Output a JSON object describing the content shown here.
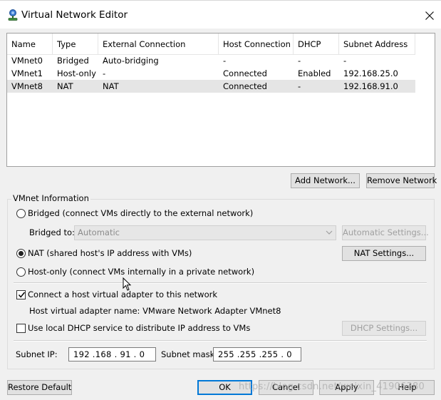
{
  "window": {
    "title": "Virtual Network Editor"
  },
  "table": {
    "columns": [
      "Name",
      "Type",
      "External Connection",
      "Host Connection",
      "DHCP",
      "Subnet Address"
    ],
    "rows": [
      [
        "VMnet0",
        "Bridged",
        "Auto-bridging",
        "-",
        "-",
        "-"
      ],
      [
        "VMnet1",
        "Host-only",
        "-",
        "Connected",
        "Enabled",
        "192.168.25.0"
      ],
      [
        "VMnet8",
        "NAT",
        "NAT",
        "Connected",
        "-",
        "192.168.91.0"
      ]
    ],
    "selected_row": "VMnet8"
  },
  "network_buttons": {
    "add": "Add Network...",
    "remove": "Remove Network"
  },
  "vmnet_info": {
    "title": "VMnet Information",
    "bridged_label": "Bridged (connect VMs directly to the external network)",
    "bridged_to_label": "Bridged to:",
    "bridged_to_value": "Automatic",
    "auto_settings_label": "Automatic Settings...",
    "nat_label": "NAT (shared host's IP address with VMs)",
    "nat_settings_label": "NAT Settings...",
    "hostonly_label": "Host-only (connect VMs internally in a private network)",
    "selected_mode": "NAT",
    "connect_adapter_label": "Connect a host virtual adapter to this network",
    "connect_adapter_checked": true,
    "adapter_name_text": "Host virtual adapter name: VMware Network Adapter VMnet8",
    "dhcp_label": "Use local DHCP service to distribute IP address to VMs",
    "dhcp_checked": false,
    "dhcp_settings_label": "DHCP Settings...",
    "subnet_ip_label": "Subnet IP:",
    "subnet_ip_value": "192 .168 . 91  . 0",
    "subnet_mask_label": "Subnet mask:",
    "subnet_mask_value": "255 .255 .255 . 0"
  },
  "footer": {
    "restore_default": "Restore Default",
    "ok": "OK",
    "cancel": "Cancel",
    "apply": "Apply",
    "help": "Help"
  },
  "watermark": "https://blog.csdn.net/weixin_41906380",
  "colors": {
    "selection": "#e5e5e5",
    "default_button_border": "#0078d7",
    "dialog_bg": "#f0f0f0"
  },
  "icons": [
    "network-app-icon",
    "close-icon",
    "chevron-down-icon",
    "checkmark-icon",
    "mouse-cursor-icon"
  ]
}
